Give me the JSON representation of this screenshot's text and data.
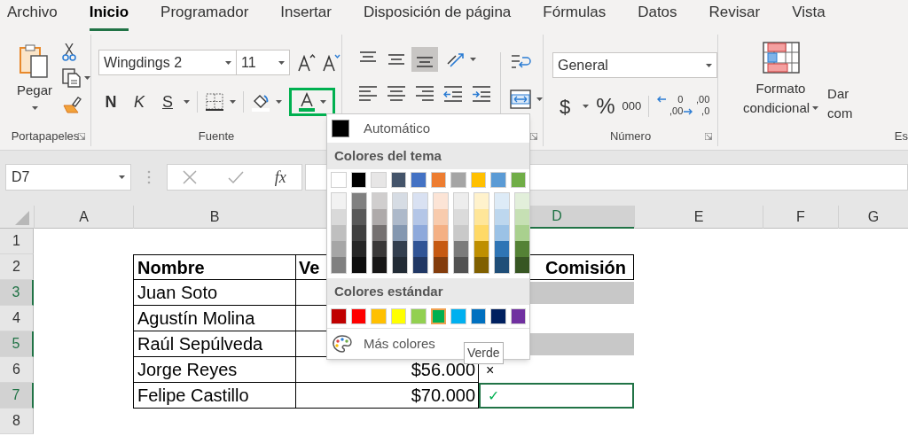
{
  "tabs": [
    {
      "label": "Archivo",
      "selected": false
    },
    {
      "label": "Inicio",
      "selected": true
    },
    {
      "label": "Programador",
      "selected": false
    },
    {
      "label": "Insertar",
      "selected": false
    },
    {
      "label": "Disposición de página",
      "selected": false
    },
    {
      "label": "Fórmulas",
      "selected": false
    },
    {
      "label": "Datos",
      "selected": false
    },
    {
      "label": "Revisar",
      "selected": false
    },
    {
      "label": "Vista",
      "selected": false
    }
  ],
  "ribbon": {
    "clipboard": {
      "paste": "Pegar",
      "label": "Portapapeles"
    },
    "font": {
      "name": "Wingdings 2",
      "size": "11",
      "bold": "N",
      "italic": "K",
      "underline": "S",
      "label": "Fuente"
    },
    "alignment": {
      "vertical": [
        {
          "kind": "top",
          "selected": false
        },
        {
          "kind": "middle",
          "selected": false
        },
        {
          "kind": "bottom",
          "selected": true
        }
      ]
    },
    "number": {
      "format": "General",
      "currency": "$",
      "percent": "%",
      "thousands": "000",
      "increase_decimal": [
        "0",
        ",00"
      ],
      "decrease_decimal": [
        ",00",
        ",0"
      ],
      "label": "Número"
    },
    "styles": {
      "conditional": [
        "Formato",
        "condicional"
      ],
      "next": [
        "Dar",
        "com"
      ],
      "label": "Es"
    }
  },
  "formula_bar": {
    "name_box": "D7",
    "function_label": "fx"
  },
  "sheet": {
    "columns": [
      {
        "label": "A",
        "selected": false
      },
      {
        "label": "B",
        "selected": false
      },
      {
        "label": "D",
        "selected": true
      },
      {
        "label": "E",
        "selected": false
      },
      {
        "label": "F",
        "selected": false
      },
      {
        "label": "G",
        "selected": false
      }
    ],
    "rows": [
      {
        "label": "1",
        "selected": false,
        "kind": "blank"
      },
      {
        "label": "2",
        "selected": false,
        "kind": "header",
        "name": "Nombre",
        "sales": "Ve",
        "commission": "Comisión"
      },
      {
        "label": "3",
        "selected": true,
        "kind": "data",
        "name": "Juan Soto",
        "shaded": true
      },
      {
        "label": "4",
        "selected": false,
        "kind": "data",
        "name": "Agustín Molina",
        "shaded": false
      },
      {
        "label": "5",
        "selected": true,
        "kind": "data",
        "name": "Raúl Sepúlveda",
        "shaded": true
      },
      {
        "label": "6",
        "selected": false,
        "kind": "data",
        "name": "Jorge Reyes",
        "sales": "$56.000",
        "commission": "×",
        "commission_positive": false,
        "shaded": false
      },
      {
        "label": "7",
        "selected": true,
        "kind": "data",
        "name": "Felipe Castillo",
        "sales": "$70.000",
        "commission": "✓",
        "commission_positive": true,
        "shaded": false,
        "active": true
      },
      {
        "label": "8",
        "selected": false,
        "kind": "blank"
      }
    ]
  },
  "palette": {
    "automatic": "Automático",
    "theme_title": "Colores del tema",
    "theme_colors": [
      {
        "color": "#ffffff",
        "shades": [
          {
            "color": "#f2f2f2"
          },
          {
            "color": "#d9d9d9"
          },
          {
            "color": "#bfbfbf"
          },
          {
            "color": "#a6a6a6"
          },
          {
            "color": "#808080"
          }
        ]
      },
      {
        "color": "#000000",
        "shades": [
          {
            "color": "#808080"
          },
          {
            "color": "#595959"
          },
          {
            "color": "#404040"
          },
          {
            "color": "#262626"
          },
          {
            "color": "#0d0d0d"
          }
        ]
      },
      {
        "color": "#e7e6e6",
        "shades": [
          {
            "color": "#d0cece"
          },
          {
            "color": "#aeaaaa"
          },
          {
            "color": "#757171"
          },
          {
            "color": "#3a3838"
          },
          {
            "color": "#171616"
          }
        ]
      },
      {
        "color": "#44546a",
        "shades": [
          {
            "color": "#d6dce4"
          },
          {
            "color": "#adb9ca"
          },
          {
            "color": "#8497b0"
          },
          {
            "color": "#333f4f"
          },
          {
            "color": "#222b35"
          }
        ]
      },
      {
        "color": "#4472c4",
        "shades": [
          {
            "color": "#d9e1f2"
          },
          {
            "color": "#b4c6e7"
          },
          {
            "color": "#8ea9db"
          },
          {
            "color": "#305496"
          },
          {
            "color": "#203764"
          }
        ]
      },
      {
        "color": "#ed7d31",
        "shades": [
          {
            "color": "#fce4d6"
          },
          {
            "color": "#f8cbad"
          },
          {
            "color": "#f4b084"
          },
          {
            "color": "#c65911"
          },
          {
            "color": "#833c0c"
          }
        ]
      },
      {
        "color": "#a5a5a5",
        "shades": [
          {
            "color": "#ededed"
          },
          {
            "color": "#dbdbdb"
          },
          {
            "color": "#c9c9c9"
          },
          {
            "color": "#7b7b7b"
          },
          {
            "color": "#525252"
          }
        ]
      },
      {
        "color": "#ffc000",
        "shades": [
          {
            "color": "#fff2cc"
          },
          {
            "color": "#ffe699"
          },
          {
            "color": "#ffd966"
          },
          {
            "color": "#bf8f00"
          },
          {
            "color": "#806000"
          }
        ]
      },
      {
        "color": "#5b9bd5",
        "shades": [
          {
            "color": "#ddebf7"
          },
          {
            "color": "#bdd7ee"
          },
          {
            "color": "#9bc2e6"
          },
          {
            "color": "#2f75b5"
          },
          {
            "color": "#1f4e78"
          }
        ]
      },
      {
        "color": "#70ad47",
        "shades": [
          {
            "color": "#e2efda"
          },
          {
            "color": "#c6e0b4"
          },
          {
            "color": "#a9d08e"
          },
          {
            "color": "#548235"
          },
          {
            "color": "#375623"
          }
        ]
      }
    ],
    "standard_title": "Colores estándar",
    "standard_colors": [
      {
        "color": "#c00000",
        "selected": false
      },
      {
        "color": "#ff0000",
        "selected": false
      },
      {
        "color": "#ffc000",
        "selected": false
      },
      {
        "color": "#ffff00",
        "selected": false
      },
      {
        "color": "#92d050",
        "selected": false
      },
      {
        "color": "#00b050",
        "selected": true
      },
      {
        "color": "#00b0f0",
        "selected": false
      },
      {
        "color": "#0070c0",
        "selected": false
      },
      {
        "color": "#002060",
        "selected": false
      },
      {
        "color": "#7030a0",
        "selected": false
      }
    ],
    "more": "Más colores",
    "tooltip": "Verde"
  }
}
